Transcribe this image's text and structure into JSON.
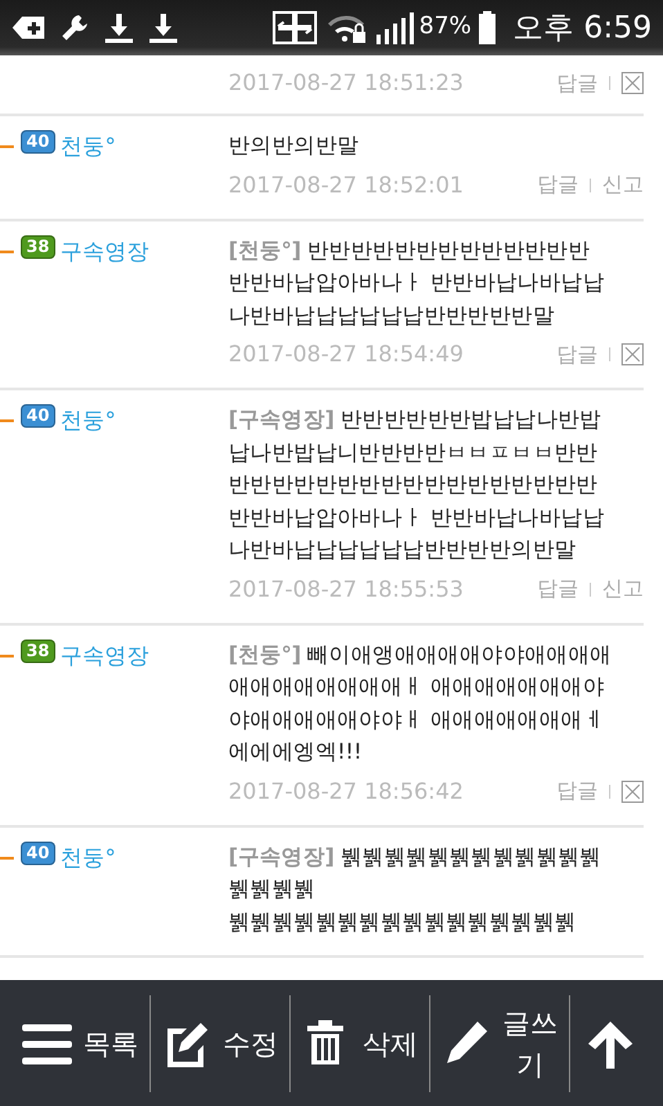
{
  "status_bar": {
    "battery": "87%",
    "time": "오후 6:59"
  },
  "comments": [
    {
      "date": "2017-08-27 18:51:23",
      "actions": [
        {
          "kind": "text",
          "label": "답글"
        },
        {
          "kind": "delete"
        }
      ]
    },
    {
      "level": "40",
      "color": "#3b8fd3",
      "nickname": "천둥°",
      "lines": [
        "반의반의반말"
      ],
      "date": "2017-08-27 18:52:01",
      "actions": [
        {
          "kind": "text",
          "label": "답글"
        },
        {
          "kind": "text",
          "label": "신고"
        }
      ]
    },
    {
      "level": "38",
      "color": "#4f9a1e",
      "nickname": "구속영장",
      "lines": [
        "**[천둥°]** 반반반반반반반반반반반반반",
        "반반바납압아바나ㅏ 반반바납나바납납",
        "나반바납납납납납납반반반반반말"
      ],
      "date": "2017-08-27 18:54:49",
      "actions": [
        {
          "kind": "text",
          "label": "답글"
        },
        {
          "kind": "delete"
        }
      ]
    },
    {
      "level": "40",
      "color": "#3b8fd3",
      "nickname": "천둥°",
      "lines": [
        "**[구속영장]** 반반반반반반밥납납나반밥",
        "납나반밥납니반반반반ㅂㅂㅍㅂㅂ반반",
        "반반반반반반반반반반반반반반반반반",
        "반반바납압아바나ㅏ 반반바납나바납납",
        "나반바납납납납납납반반반반의반말"
      ],
      "date": "2017-08-27 18:55:53",
      "actions": [
        {
          "kind": "text",
          "label": "답글"
        },
        {
          "kind": "text",
          "label": "신고"
        }
      ]
    },
    {
      "level": "38",
      "color": "#4f9a1e",
      "nickname": "구속영장",
      "lines": [
        "**[천둥°]** 빼이애앵애애애애야야애애애애",
        "애애애애애애애애ㅐ 애애애애애애애야",
        "야애애애애애야야ㅐ 애애애애애애애ㅔ",
        "에에에엥엑!!!"
      ],
      "date": "2017-08-27 18:56:42",
      "actions": [
        {
          "kind": "text",
          "label": "답글"
        },
        {
          "kind": "delete"
        }
      ]
    },
    {
      "level": "40",
      "color": "#3b8fd3",
      "nickname": "천둥°",
      "lines": [
        "**[구속영장]** 뷁뷁뷁뷁뷁뷁뷁뷁뷁뷁뷁뷁",
        "뷁뷁뷁뷁",
        "뷁뷁뷁뷁뷁뷁뷁뷁뷁뷁뷁뷁뷁뷁뷁뷁"
      ]
    }
  ],
  "toolbar": [
    {
      "kind": "menu",
      "label": "목록"
    },
    {
      "kind": "edit",
      "label": "수정"
    },
    {
      "kind": "delete",
      "label": "삭제"
    },
    {
      "kind": "write",
      "label": "글쓰기"
    },
    {
      "kind": "top"
    }
  ]
}
